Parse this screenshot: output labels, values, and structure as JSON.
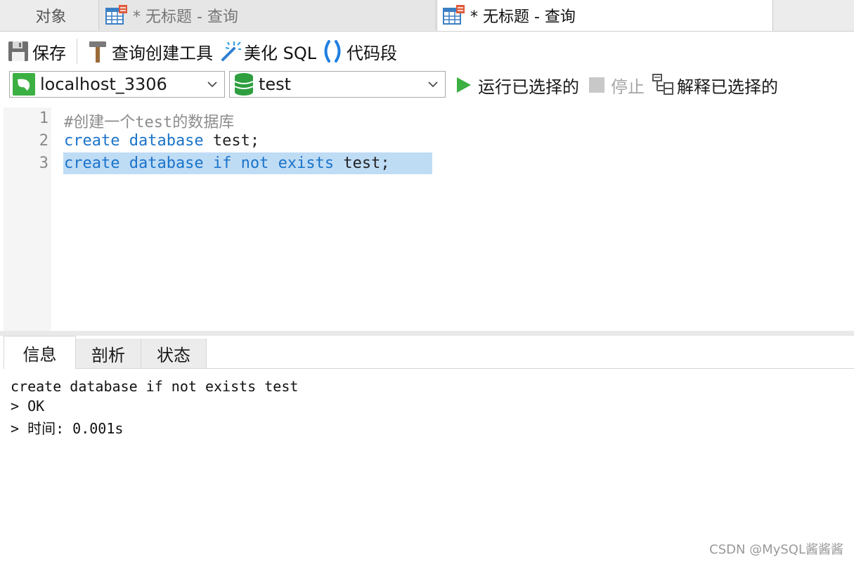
{
  "tabs": {
    "objects": "对象",
    "query_1": "* 无标题 - 查询",
    "query_2": "* 无标题 - 查询"
  },
  "toolbar": {
    "save": "保存",
    "query_builder": "查询创建工具",
    "beautify_sql": "美化 SQL",
    "code_snippet": "代码段"
  },
  "connection": {
    "selected": "localhost_3306",
    "database": "test",
    "run_selected": "运行已选择的",
    "stop": "停止",
    "explain_selected": "解释已选择的"
  },
  "editor": {
    "lines": [
      {
        "number": "1",
        "text": "#创建一个test的数据库"
      },
      {
        "number": "2",
        "kw": "create database",
        "rest": " test;"
      },
      {
        "number": "3",
        "kw": "create database if not exists",
        "rest": " test;"
      }
    ],
    "selected_line": 3
  },
  "result": {
    "tabs": [
      "信息",
      "剖析",
      "状态"
    ],
    "active_tab": "信息",
    "output": [
      "create database if not exists test",
      "> OK",
      "> 时间: 0.001s"
    ]
  },
  "watermark": "CSDN @MySQL酱酱酱",
  "colors": {
    "keyword": "#1a73c9",
    "selection": "#bfdcf5",
    "run_icon": "#3cb043",
    "db_icon": "#2e9e3e",
    "table_icon_accent": "#e05a3a"
  },
  "icons": [
    "table-query-icon",
    "save-icon",
    "hammer-icon",
    "magic-wand-icon",
    "parentheses-icon",
    "server-icon",
    "database-icon",
    "chevron-down-icon",
    "play-icon",
    "stop-icon",
    "explain-icon"
  ]
}
